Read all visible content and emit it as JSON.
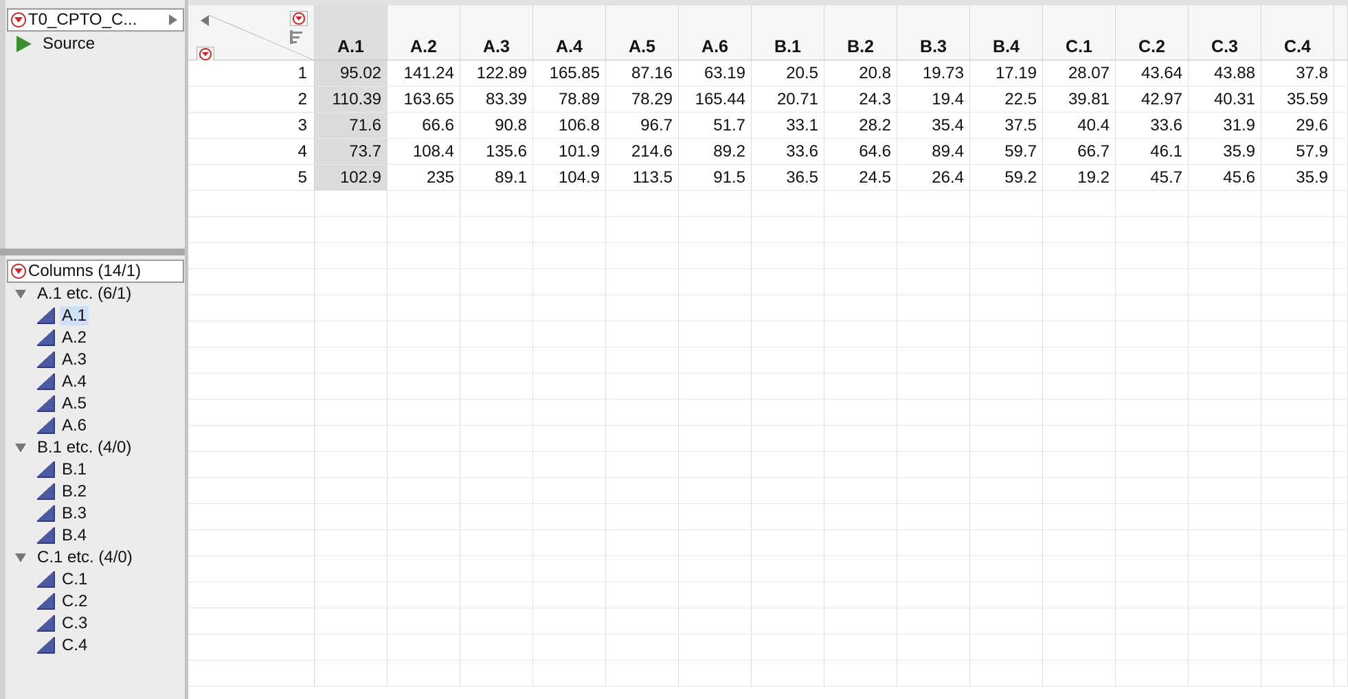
{
  "table_panel": {
    "title": "T0_CPTO_C...",
    "source_label": "Source"
  },
  "columns_panel": {
    "title": "Columns (14/1)",
    "groups": [
      {
        "label": "A.1 etc. (6/1)",
        "items": [
          "A.1",
          "A.2",
          "A.3",
          "A.4",
          "A.5",
          "A.6"
        ]
      },
      {
        "label": "B.1 etc. (4/0)",
        "items": [
          "B.1",
          "B.2",
          "B.3",
          "B.4"
        ]
      },
      {
        "label": "C.1 etc. (4/0)",
        "items": [
          "C.1",
          "C.2",
          "C.3",
          "C.4"
        ]
      }
    ],
    "selected": "A.1"
  },
  "grid": {
    "columns": [
      "A.1",
      "A.2",
      "A.3",
      "A.4",
      "A.5",
      "A.6",
      "B.1",
      "B.2",
      "B.3",
      "B.4",
      "C.1",
      "C.2",
      "C.3",
      "C.4"
    ],
    "selected_column": "A.1",
    "rows": [
      {
        "n": "1",
        "cells": [
          "95.02",
          "141.24",
          "122.89",
          "165.85",
          "87.16",
          "63.19",
          "20.5",
          "20.8",
          "19.73",
          "17.19",
          "28.07",
          "43.64",
          "43.88",
          "37.8"
        ]
      },
      {
        "n": "2",
        "cells": [
          "110.39",
          "163.65",
          "83.39",
          "78.89",
          "78.29",
          "165.44",
          "20.71",
          "24.3",
          "19.4",
          "22.5",
          "39.81",
          "42.97",
          "40.31",
          "35.59"
        ]
      },
      {
        "n": "3",
        "cells": [
          "71.6",
          "66.6",
          "90.8",
          "106.8",
          "96.7",
          "51.7",
          "33.1",
          "28.2",
          "35.4",
          "37.5",
          "40.4",
          "33.6",
          "31.9",
          "29.6"
        ]
      },
      {
        "n": "4",
        "cells": [
          "73.7",
          "108.4",
          "135.6",
          "101.9",
          "214.6",
          "89.2",
          "33.6",
          "64.6",
          "89.4",
          "59.7",
          "66.7",
          "46.1",
          "35.9",
          "57.9"
        ]
      },
      {
        "n": "5",
        "cells": [
          "102.9",
          "235",
          "89.1",
          "104.9",
          "113.5",
          "91.5",
          "36.5",
          "24.5",
          "26.4",
          "59.2",
          "19.2",
          "45.7",
          "45.6",
          "35.9"
        ]
      }
    ],
    "empty_rows": 19
  },
  "colors": {
    "accent_red": "#c72828",
    "column_icon": "#4b5aa6",
    "selection": "#cfe0f8"
  }
}
